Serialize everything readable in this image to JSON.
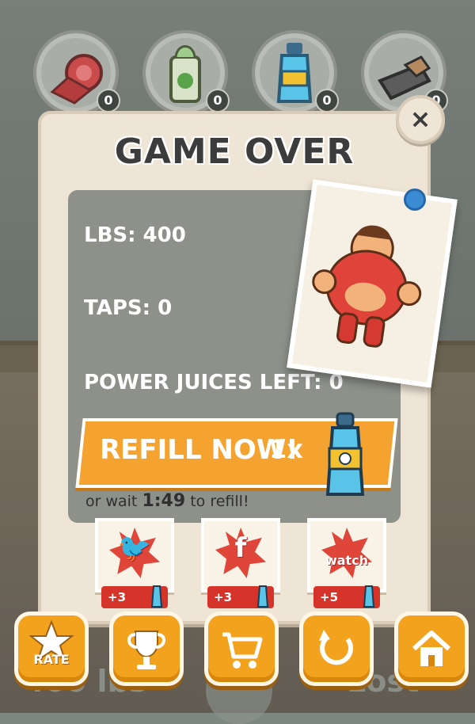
{
  "top_items": [
    {
      "icon": "meat-roll-icon",
      "count": "0"
    },
    {
      "icon": "spinach-can-icon",
      "count": "0"
    },
    {
      "icon": "power-juice-icon",
      "count": "0"
    },
    {
      "icon": "protein-bar-icon",
      "count": "0"
    }
  ],
  "panel": {
    "title": "GAME OVER",
    "stats": [
      {
        "label": "LBS: 400"
      },
      {
        "label": "TAPS: 0"
      },
      {
        "label": "POWER JUICES LEFT: 0"
      }
    ],
    "close_label": "×"
  },
  "refill": {
    "label": "REFILL NOW!",
    "count": "1x"
  },
  "wait": {
    "prefix": "or wait",
    "time": "1:49",
    "suffix": "to refill!"
  },
  "social": [
    {
      "name": "twitter",
      "icon_glyph": "🐦",
      "reward": "+3"
    },
    {
      "name": "facebook",
      "icon_glyph": "f",
      "reward": "+3"
    },
    {
      "name": "watch",
      "icon_glyph": "watch",
      "reward": "+5"
    }
  ],
  "bottom_bar": {
    "rate_label": "RATE"
  },
  "hud": {
    "left": "400 lbs",
    "right": "Lost"
  },
  "colors": {
    "accent": "#f4a330",
    "panel": "#efe5d6",
    "reward": "#d6342a"
  }
}
